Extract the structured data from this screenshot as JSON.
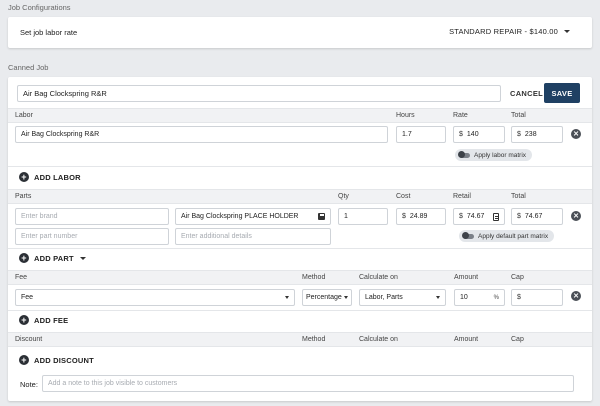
{
  "job_config": {
    "section_title": "Job Configurations",
    "labor_rate_label": "Set job labor rate",
    "labor_rate_value": "STANDARD REPAIR - $140.00"
  },
  "canned_job": {
    "section_title": "Canned Job",
    "job_name": "Air Bag Clockspring R&R",
    "cancel_label": "CANCEL",
    "save_label": "SAVE"
  },
  "labor": {
    "headers": {
      "labor": "Labor",
      "hours": "Hours",
      "rate": "Rate",
      "total": "Total"
    },
    "row": {
      "description": "Air Bag Clockspring R&R",
      "hours": "1.7",
      "rate_prefix": "$",
      "rate": "140",
      "total_prefix": "$",
      "total": "238"
    },
    "matrix_label": "Apply labor matrix",
    "add_label": "ADD LABOR"
  },
  "parts": {
    "headers": {
      "parts": "Parts",
      "qty": "Qty",
      "cost": "Cost",
      "retail": "Retail",
      "total": "Total"
    },
    "row": {
      "brand_placeholder": "Enter brand",
      "name": "Air Bag Clockspring PLACE HOLDER",
      "qty": "1",
      "cost_prefix": "$",
      "cost": "24.89",
      "retail_prefix": "$",
      "retail": "74.67",
      "total_prefix": "$",
      "total": "74.67",
      "part_number_placeholder": "Enter part number",
      "details_placeholder": "Enter additional details"
    },
    "matrix_label": "Apply default part matrix",
    "add_label": "ADD PART"
  },
  "fees": {
    "headers": {
      "fee": "Fee",
      "method": "Method",
      "calculate_on": "Calculate on",
      "amount": "Amount",
      "cap": "Cap"
    },
    "row": {
      "fee": "Fee",
      "method": "Percentage",
      "calculate_on": "Labor, Parts",
      "amount": "10",
      "amount_suffix": "%",
      "cap_prefix": "$"
    },
    "add_label": "ADD FEE"
  },
  "discounts": {
    "headers": {
      "discount": "Discount",
      "method": "Method",
      "calculate_on": "Calculate on",
      "amount": "Amount",
      "cap": "Cap"
    },
    "add_label": "ADD DISCOUNT"
  },
  "note": {
    "label": "Note:",
    "placeholder": "Add a note to this job visible to customers"
  },
  "colors": {
    "primary": "#1f4063",
    "background": "#e9ebee"
  }
}
